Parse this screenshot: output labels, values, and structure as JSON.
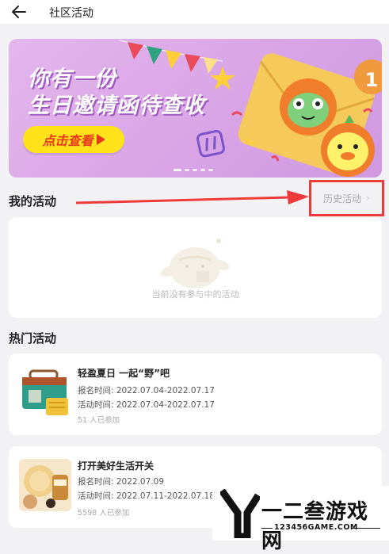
{
  "header": {
    "title": "社区活动"
  },
  "banner": {
    "line1": "你有一份",
    "line2": "生日邀请函待查收",
    "button_label": "点击查看",
    "badge_number": "1"
  },
  "my_activities": {
    "title": "我的活动",
    "history_label": "历史活动",
    "empty_text": "当前没有参与中的活动"
  },
  "hot_activities": {
    "title": "热门活动",
    "items": [
      {
        "name": "轻盈夏日 一起“野”吧",
        "signup": "报名时间:  2022.07.04-2022.07.17",
        "activity": "活动时间:  2022.07.04-2022.07.17",
        "participants": "51 人已参加"
      },
      {
        "name": "打开美好生活开关",
        "signup": "报名时间:  2022.07.09",
        "activity": "活动时间:  2022.07.11-2022.07.18",
        "participants": "5598 人已参加"
      }
    ]
  },
  "watermark": {
    "title": "一二叁游戏网",
    "url": "123456GAME.COM"
  },
  "colors": {
    "banner_bg": "#dcaae8",
    "button_yellow": "#ffe21a",
    "button_text": "#e6391c",
    "annotation_red": "#ee3a3a"
  }
}
